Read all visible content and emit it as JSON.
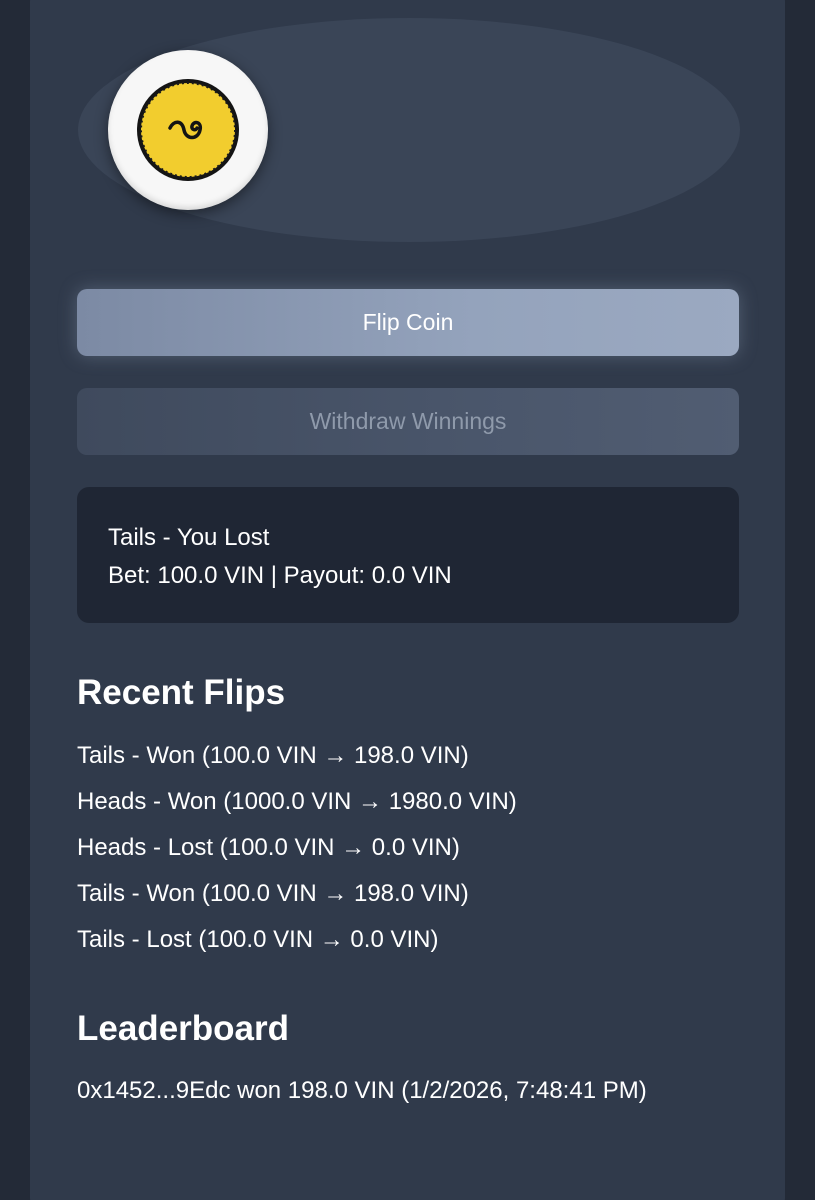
{
  "controls": {
    "flip_label": "Flip Coin",
    "withdraw_label": "Withdraw Winnings"
  },
  "result": {
    "outcome": "Tails - You Lost",
    "details": "Bet: 100.0 VIN | Payout: 0.0 VIN"
  },
  "recent_flips": {
    "title": "Recent Flips",
    "items": [
      "Tails - Won (100.0 VIN → 198.0 VIN)",
      "Heads - Won (1000.0 VIN → 1980.0 VIN)",
      "Heads - Lost (100.0 VIN → 0.0 VIN)",
      "Tails - Won (100.0 VIN → 198.0 VIN)",
      "Tails - Lost (100.0 VIN → 0.0 VIN)"
    ]
  },
  "leaderboard": {
    "title": "Leaderboard",
    "entries": [
      "0x1452...9Edc won 198.0 VIN (1/2/2026, 7:48:41 PM)"
    ]
  },
  "icons": {
    "coin": "coin-icon"
  },
  "colors": {
    "background": "#232a37",
    "card": "#303a4b",
    "coin_gold": "#f2cd2e",
    "primary_button": "#94a3bc",
    "result_box": "#1f2634"
  }
}
